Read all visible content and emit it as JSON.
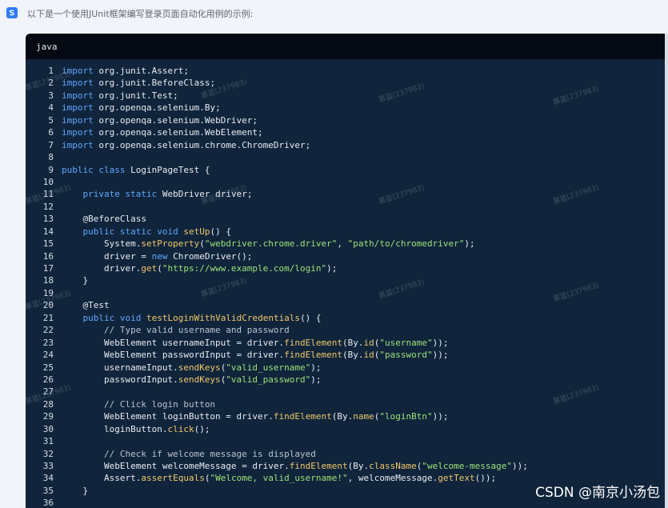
{
  "intro": {
    "text": "以下是一个使用JUnit框架编写登录页面自动化用例的示例:"
  },
  "code_block": {
    "language": "java",
    "lines": [
      {
        "n": "1",
        "html": "<span class='kw'>import</span> org.junit.Assert;"
      },
      {
        "n": "2",
        "html": "<span class='kw'>import</span> org.junit.BeforeClass;"
      },
      {
        "n": "3",
        "html": "<span class='kw'>import</span> org.junit.Test;"
      },
      {
        "n": "4",
        "html": "<span class='kw'>import</span> org.openqa.selenium.By;"
      },
      {
        "n": "5",
        "html": "<span class='kw'>import</span> org.openqa.selenium.WebDriver;"
      },
      {
        "n": "6",
        "html": "<span class='kw'>import</span> org.openqa.selenium.WebElement;"
      },
      {
        "n": "7",
        "html": "<span class='kw'>import</span> org.openqa.selenium.chrome.ChromeDriver;"
      },
      {
        "n": "8",
        "html": ""
      },
      {
        "n": "9",
        "html": "<span class='kw'>public</span> <span class='kw'>class</span> LoginPageTest {"
      },
      {
        "n": "10",
        "html": ""
      },
      {
        "n": "11",
        "html": "    <span class='kw'>private</span> <span class='kw'>static</span> WebDriver driver;"
      },
      {
        "n": "12",
        "html": ""
      },
      {
        "n": "13",
        "html": "    <span class='an'>@BeforeClass</span>"
      },
      {
        "n": "14",
        "html": "    <span class='kw'>public</span> <span class='kw'>static</span> <span class='kw'>void</span> <span class='fn'>setUp</span>() {"
      },
      {
        "n": "15",
        "html": "        System.<span class='fn'>setProperty</span>(<span class='str'>\"webdriver.chrome.driver\"</span>, <span class='str'>\"path/to/chromedriver\"</span>);"
      },
      {
        "n": "16",
        "html": "        driver = <span class='kw'>new</span> ChromeDriver();"
      },
      {
        "n": "17",
        "html": "        driver.<span class='fn'>get</span>(<span class='str'>\"https://www.example.com/login\"</span>);"
      },
      {
        "n": "18",
        "html": "    }"
      },
      {
        "n": "19",
        "html": ""
      },
      {
        "n": "20",
        "html": "    <span class='an'>@Test</span>"
      },
      {
        "n": "21",
        "html": "    <span class='kw'>public</span> <span class='kw'>void</span> <span class='fn'>testLoginWithValidCredentials</span>() {"
      },
      {
        "n": "22",
        "html": "        <span class='cm'>// Type valid username and password</span>"
      },
      {
        "n": "23",
        "html": "        WebElement usernameInput = driver.<span class='fn'>findElement</span>(By.<span class='fn'>id</span>(<span class='str'>\"username\"</span>));"
      },
      {
        "n": "24",
        "html": "        WebElement passwordInput = driver.<span class='fn'>findElement</span>(By.<span class='fn'>id</span>(<span class='str'>\"password\"</span>));"
      },
      {
        "n": "25",
        "html": "        usernameInput.<span class='fn'>sendKeys</span>(<span class='str'>\"valid_username\"</span>);"
      },
      {
        "n": "26",
        "html": "        passwordInput.<span class='fn'>sendKeys</span>(<span class='str'>\"valid_password\"</span>);"
      },
      {
        "n": "27",
        "html": ""
      },
      {
        "n": "28",
        "html": "        <span class='cm'>// Click login button</span>"
      },
      {
        "n": "29",
        "html": "        WebElement loginButton = driver.<span class='fn'>findElement</span>(By.<span class='fn'>name</span>(<span class='str'>\"loginBtn\"</span>));"
      },
      {
        "n": "30",
        "html": "        loginButton.<span class='fn'>click</span>();"
      },
      {
        "n": "31",
        "html": ""
      },
      {
        "n": "32",
        "html": "        <span class='cm'>// Check if welcome message is displayed</span>"
      },
      {
        "n": "33",
        "html": "        WebElement welcomeMessage = driver.<span class='fn'>findElement</span>(By.<span class='fn'>className</span>(<span class='str'>\"welcome-message\"</span>));"
      },
      {
        "n": "34",
        "html": "        Assert.<span class='fn'>assertEquals</span>(<span class='str'>\"Welcome, valid_username!\"</span>, welcomeMessage.<span class='fn'>getText</span>());"
      },
      {
        "n": "35",
        "html": "    }"
      },
      {
        "n": "36",
        "html": ""
      }
    ]
  },
  "watermarks": [
    "慕蓝(237983)",
    "慕蓝(237983)",
    "慕蓝(237983)",
    "慕蓝(237983)",
    "慕蓝(237983)",
    "慕蓝(237983)",
    "慕蓝(237983)",
    "慕蓝(237983)",
    "慕蓝(237983)",
    "慕蓝(237983)",
    "慕蓝(237983)",
    "慕蓝(237983)",
    "慕蓝(237983)",
    "慕蓝(237983)"
  ],
  "footer": {
    "text": "CSDN @南京小汤包"
  },
  "colors": {
    "keyword": "#5fa8ff",
    "function": "#f0c86a",
    "string": "#9fe37a",
    "comment": "#b9c3cf",
    "code_background": "#10243b",
    "header_background": "#050a12"
  }
}
